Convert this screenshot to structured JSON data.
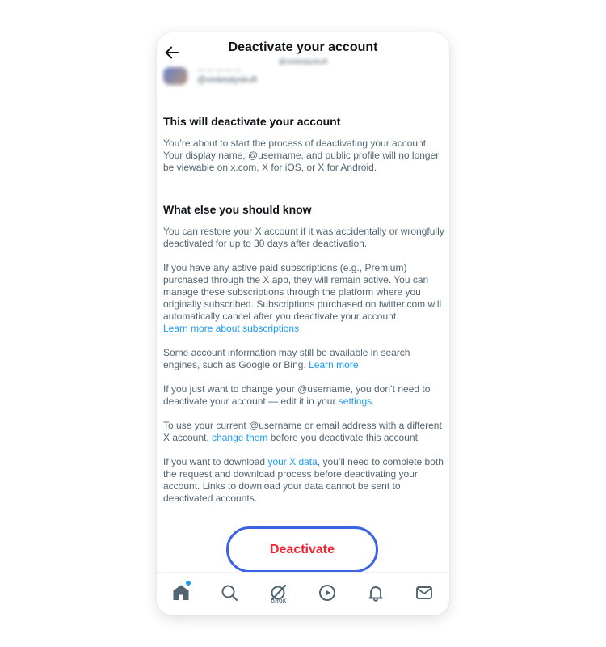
{
  "header": {
    "title": "Deactivate your account",
    "subtitle": "@violetalyskuft"
  },
  "account": {
    "name": "— — — — —",
    "handle": "@violetalyskuft"
  },
  "section1": {
    "heading": "This will deactivate your account",
    "body": "You’re about to start the process of deactivating your account. Your display name, @username, and public profile will no longer be viewable on x.com, X for iOS, or X for Android."
  },
  "section2": {
    "heading": "What else you should know",
    "p1": "You can restore your X account if it was accidentally or wrongfully deactivated for up to 30 days after deactivation.",
    "p2": "If you have any active paid subscriptions (e.g., Premium) purchased through the X app, they will remain active. You can manage these subscriptions through the platform where you originally subscribed. Subscriptions purchased on twitter.com will automatically cancel after you deactivate your account.",
    "p2_link": "Learn more about subscriptions",
    "p3": "Some account information may still be available in search engines, such as Google or Bing.",
    "p3_link": "Learn more",
    "p4_pre": "If you just want to change your @username, you don’t need to deactivate your account — edit it in your",
    "p4_link": "settings",
    "p4_post": ".",
    "p5_pre": "To use your current @username or email address with a different X account,",
    "p5_link": "change them",
    "p5_post": "before you deactivate this account.",
    "p6_pre": "If you want to download",
    "p6_link": "your X data",
    "p6_post": ", you’ll need to complete both the request and download process before deactivating your account. Links to download your data cannot be sent to deactivated accounts."
  },
  "actions": {
    "deactivate_label": "Deactivate"
  },
  "tabbar": {
    "grok_label": "GROK",
    "items": [
      "home-icon",
      "search-icon",
      "grok-icon",
      "video-icon",
      "notifications-icon",
      "messages-icon"
    ]
  },
  "colors": {
    "link": "#1d9bf0",
    "danger": "#f4212e",
    "focus_ring": "#3b63e6",
    "text_primary": "#0f1419",
    "text_secondary": "#536471"
  }
}
